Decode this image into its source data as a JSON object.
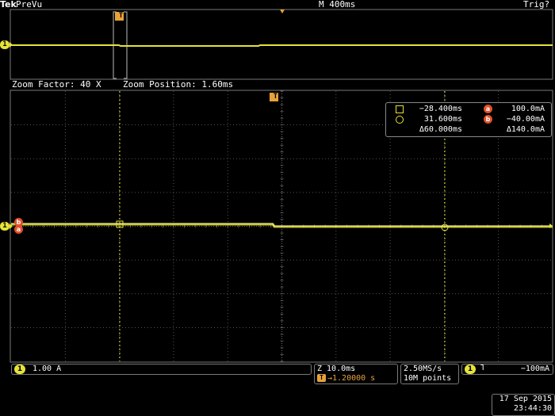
{
  "header": {
    "brand": "Tek",
    "acq_state": "PreVu",
    "timebase": "M 400ms",
    "trigger_status": "Trig?"
  },
  "overview": {
    "trigger_marker": "T",
    "channel_marker": "1"
  },
  "zoom": {
    "factor_label": "Zoom Factor: 40 X",
    "position_label": "Zoom Position: 1.60ms",
    "trigger_marker": "T",
    "channel_marker": "1",
    "cursor_b_marker": "b",
    "cursor_a_marker": "a"
  },
  "measurements": {
    "cursor1_time": "−28.400ms",
    "cursor_a_label": "a",
    "cursor_a_value": "100.0mA",
    "cursor2_time": "31.600ms",
    "cursor_b_label": "b",
    "cursor_b_value": "−40.00mA",
    "delta_time": "Δ60.000ms",
    "delta_value": "Δ140.0mA"
  },
  "status": {
    "ch1_badge": "1",
    "ch1_scale": "1.00 A",
    "zoom_scale": "Z 10.0ms",
    "trigger_position": "→1.20000 s",
    "sample_rate": "2.50MS/s",
    "record_length": "10M points",
    "trig_badge": "1",
    "trig_slope": "˥",
    "trig_level": "−100mA"
  },
  "datetime": {
    "date": "17 Sep  2015",
    "time": "23:44:30"
  },
  "colors": {
    "trace": "#e5e33a",
    "grid": "#6b6b6b",
    "screen_bg": "#000000",
    "border": "#7a7a7a",
    "cursor_badge": "#e0502a",
    "accent": "#e8a23b"
  }
}
